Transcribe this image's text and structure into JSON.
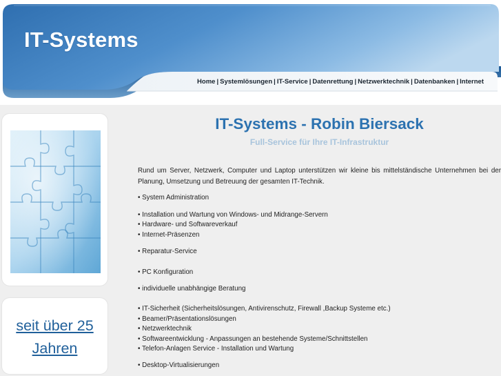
{
  "header": {
    "site_title": "IT-Systems",
    "nav": [
      "Home",
      "Systemlösungen",
      "IT-Service",
      "Datenrettung",
      "Netzwerktechnik",
      "Datenbanken",
      "Internet"
    ],
    "nav_separator": "|"
  },
  "sidebar": {
    "years_text": "seit über 25 Jahren"
  },
  "main": {
    "title": "IT-Systems - Robin Biersack",
    "subtitle": "Full-Service für Ihre IT-Infrastruktur",
    "intro": "Rund um Server, Netzwerk, Computer und Laptop unterstützen wir kleine bis mittelständische Unternehmen bei der Planung, Umsetzung und Betreuung der gesamten IT-Technik.",
    "services": [
      "• System Administration",
      "• Installation und Wartung von Windows- und Midrange-Servern",
      "• Hardware- und Softwareverkauf",
      "• Internet-Präsenzen",
      "• Reparatur-Service",
      "• PC Konfiguration",
      "• individuelle unabhängige Beratung",
      "• IT-Sicherheit (Sicherheitslösungen, Antivirenschutz, Firewall ,Backup Systeme etc.)",
      "• Beamer/Präsentationslösungen",
      "• Netzwerktechnik",
      "• Softwareentwicklung - Anpassungen an bestehende Systeme/Schnittstellen",
      "• Telefon-Anlagen Service - Installation und Wartung",
      "• Desktop-Virtualisierungen"
    ]
  },
  "colors": {
    "header_light": "#bcd8ef",
    "header_mid": "#6ea6d6",
    "header_dark": "#2f6fb0",
    "title_blue": "#2c72b0",
    "subtitle_blue": "#a8c4dc",
    "years_blue": "#1f5f9a",
    "content_bg": "#efefef"
  }
}
